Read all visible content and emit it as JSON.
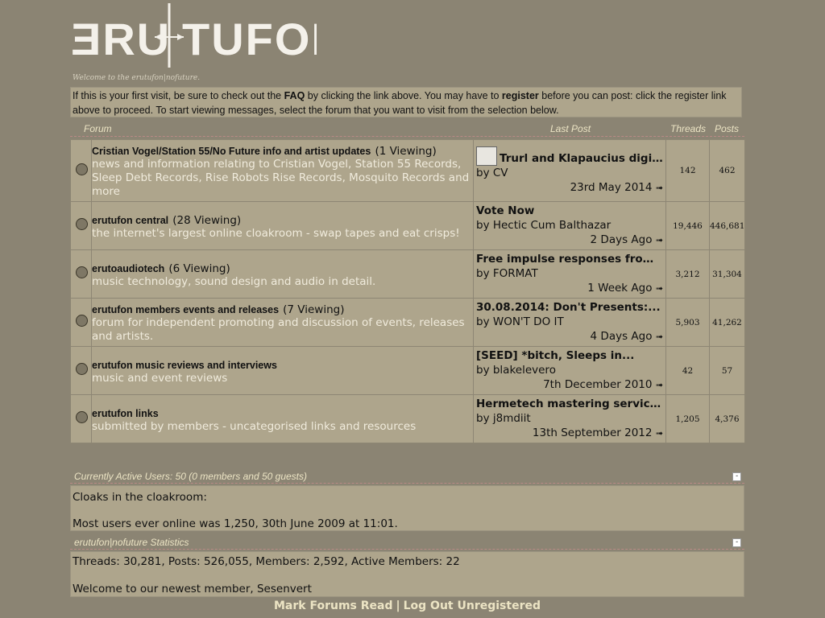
{
  "logo": {
    "text_left": "ƎRU",
    "text_right": "TUFON"
  },
  "welcome_title": "Welcome to the erutufon|nofuture.",
  "notice": {
    "p1": "If this is your first visit, be sure to check out the ",
    "faq": "FAQ",
    "p2": " by clicking the link above. You may have to ",
    "register": "register",
    "p3": " before you can post: click the register link above to proceed. To start viewing messages, select the forum that you want to visit from the selection below."
  },
  "columns": {
    "forum": "Forum",
    "last_post": "Last Post",
    "threads": "Threads",
    "posts": "Posts"
  },
  "forums": [
    {
      "name": "Cristian Vogel/Station 55/No Future info and artist updates",
      "viewing": "(1 Viewing)",
      "desc": "news and information relating to Cristian Vogel, Station 55 Records, Sleep Debt Records, Rise Robots Rise Records, Mosquito Records and more",
      "lp_title": "Trurl and Klapaucius digital...",
      "lp_by": "by CV",
      "lp_date": "23rd May 2014",
      "threads": "142",
      "posts": "462"
    },
    {
      "name": "erutufon central",
      "viewing": "(28 Viewing)",
      "desc": "the internet's largest online cloakroom - swap tapes and eat crisps!",
      "lp_title": "Vote Now",
      "lp_by": "by Hectic Cum Balthazar",
      "lp_date": "2 Days Ago",
      "threads": "19,446",
      "posts": "446,681"
    },
    {
      "name": "erutoaudiotech",
      "viewing": "(6 Viewing)",
      "desc": "music technology, sound design and audio in detail.",
      "lp_title": "Free impulse responses from...",
      "lp_by": "by FORMAT",
      "lp_date": "1 Week Ago",
      "threads": "3,212",
      "posts": "31,304"
    },
    {
      "name": "erutufon members events and releases",
      "viewing": "(7 Viewing)",
      "desc": "forum for independent promoting and discussion of events, releases and artists.",
      "lp_title": "30.08.2014: Don't Presents:...",
      "lp_by": "by WON'T DO IT",
      "lp_date": "4 Days Ago",
      "threads": "5,903",
      "posts": "41,262"
    },
    {
      "name": "erutufon music reviews and interviews",
      "viewing": "",
      "desc": "music and event reviews",
      "lp_title": "[SEED] *bitch, Sleeps in...",
      "lp_by": "by blakelevero",
      "lp_date": "7th December 2010",
      "threads": "42",
      "posts": "57"
    },
    {
      "name": "erutufon links",
      "viewing": "",
      "desc": "submitted by members - uncategorised links and resources",
      "lp_title": "Hermetech mastering services;...",
      "lp_by": "by j8mdiit",
      "lp_date": "13th September 2012",
      "threads": "1,205",
      "posts": "4,376"
    }
  ],
  "active": {
    "head": "Currently Active Users: 50 (0 members and 50 guests)",
    "line1": "Cloaks in the cloakroom:",
    "line2": "Most users ever online was 1,250, 30th June 2009 at 11:01."
  },
  "stats": {
    "head": "erutufon|nofuture Statistics",
    "line1": "Threads: 30,281, Posts: 526,055, Members: 2,592, Active Members: 22",
    "line2": "Welcome to our newest member, Sesenvert"
  },
  "footer": {
    "mark_read": "Mark Forums Read",
    "sep": "|",
    "logout": "Log Out Unregistered"
  },
  "collapse_symbol": "-",
  "arrow_glyph": "➟"
}
